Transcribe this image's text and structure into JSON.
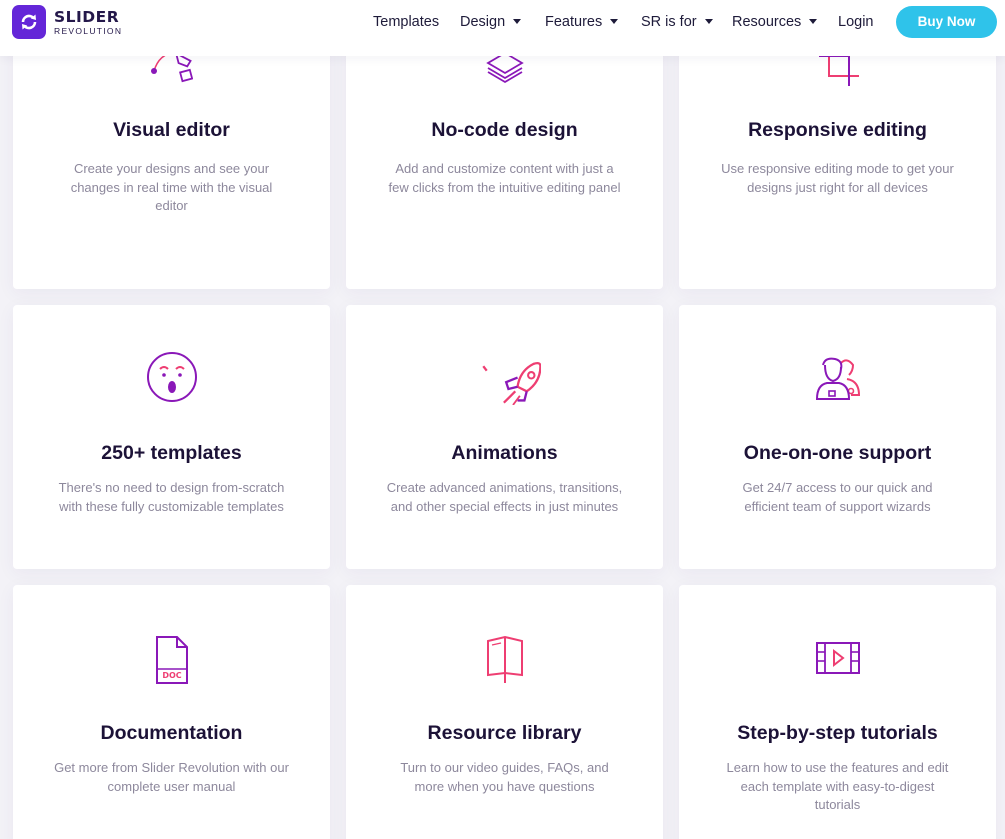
{
  "brand": {
    "name": "SLIDER",
    "subtitle": "REVOLUTION",
    "logo_color": "#6426d8"
  },
  "nav": {
    "items": [
      {
        "label": "Templates",
        "has_dropdown": false
      },
      {
        "label": "Design",
        "has_dropdown": true
      },
      {
        "label": "Features",
        "has_dropdown": true
      },
      {
        "label": "SR is for",
        "has_dropdown": true
      },
      {
        "label": "Resources",
        "has_dropdown": true
      },
      {
        "label": "Login",
        "has_dropdown": false
      }
    ],
    "cta": {
      "label": "Buy Now",
      "color": "#2fc3ea"
    }
  },
  "features": [
    {
      "icon": "pen-tool-icon",
      "title": "Visual editor",
      "description": "Create your designs and see your changes in real time with the visual editor"
    },
    {
      "icon": "layers-icon",
      "title": "No-code design",
      "description": "Add and customize content with just a few clicks from the intuitive editing panel"
    },
    {
      "icon": "crop-icon",
      "title": "Responsive editing",
      "description": "Use responsive editing mode to get your designs just right for all devices"
    },
    {
      "icon": "surprised-face-icon",
      "title": "250+ templates",
      "description": "There's no need to design from-scratch with these fully customizable templates"
    },
    {
      "icon": "rocket-icon",
      "title": "Animations",
      "description": "Create advanced animations, transitions, and other special effects in just minutes"
    },
    {
      "icon": "support-people-icon",
      "title": "One-on-one support",
      "description": "Get 24/7 access to our quick and efficient team of support wizards"
    },
    {
      "icon": "doc-file-icon",
      "title": "Documentation",
      "description": "Get more from Slider Revolution with our complete user manual"
    },
    {
      "icon": "open-book-icon",
      "title": "Resource library",
      "description": "Turn to our video guides, FAQs, and more when you have questions"
    },
    {
      "icon": "video-film-icon",
      "title": "Step-by-step tutorials",
      "description": "Learn how to use the features and edit each template with easy-to-digest tutorials"
    }
  ],
  "icon_colors": {
    "purple": "#8a18b8",
    "pink": "#ee3e72"
  }
}
